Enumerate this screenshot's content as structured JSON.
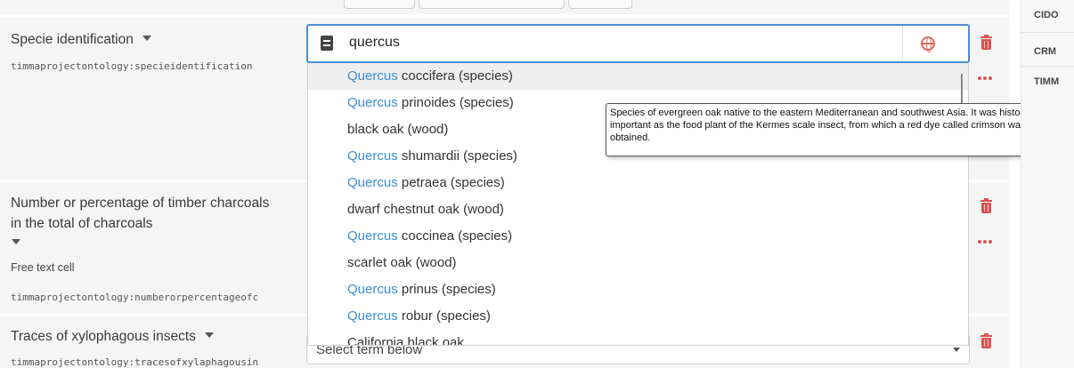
{
  "properties": [
    {
      "label": "Specie identification",
      "uri": "timmaprojectontology:specieidentification"
    },
    {
      "label_line1": "Number or percentage of timber charcoals",
      "label_line2": "in the total of charcoals",
      "sub": "Free text cell",
      "uri": "timmaprojectontology:numberorpercentageofc"
    },
    {
      "label": "Traces of xylophagous insects",
      "uri": "timmaprojectontology:tracesofxylaphagousin"
    }
  ],
  "search": {
    "value": "quercus"
  },
  "dropdown": {
    "items": [
      {
        "match": "Quercus",
        "rest": " coccifera (species)"
      },
      {
        "match": "Quercus",
        "rest": " prinoides (species)"
      },
      {
        "match": "",
        "rest": "black oak (wood)"
      },
      {
        "match": "Quercus",
        "rest": " shumardii (species)"
      },
      {
        "match": "Quercus",
        "rest": " petraea (species)"
      },
      {
        "match": "",
        "rest": "dwarf chestnut oak (wood)"
      },
      {
        "match": "Quercus",
        "rest": " coccinea (species)"
      },
      {
        "match": "",
        "rest": "scarlet oak (wood)"
      },
      {
        "match": "Quercus",
        "rest": " prinus (species)"
      },
      {
        "match": "Quercus",
        "rest": " robur (species)"
      },
      {
        "match": "",
        "rest": "California black oak"
      }
    ]
  },
  "tooltip": {
    "text": "Species of evergreen oak native to the eastern Mediterranean and southwest Asia. It was historically important as the food plant of the Kermes scale insect, from which a red dye called crimson was obtained."
  },
  "select": {
    "placeholder": "Select term below"
  },
  "right_panel": {
    "items": [
      "CIDO",
      "CRM",
      "TIMM"
    ]
  },
  "icons": {
    "delete": "trash-icon",
    "more": "more-dots-icon",
    "language": "globe-icon",
    "term": "document-icon"
  },
  "colors": {
    "accent": "#4a8fd6",
    "highlight": "#3b8fd8",
    "danger": "#d9534f"
  }
}
